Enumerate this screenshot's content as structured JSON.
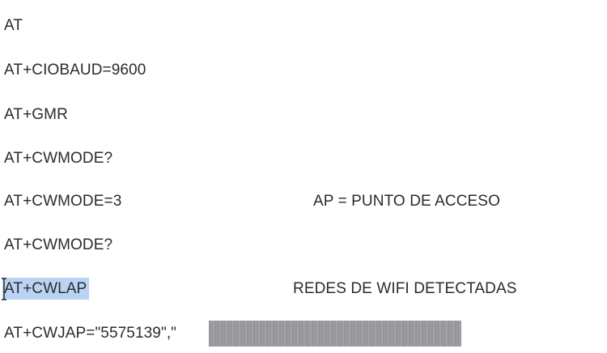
{
  "commands": {
    "at": "AT",
    "ciobaud": "AT+CIOBAUD=9600",
    "gmr": "AT+GMR",
    "cwmode_query_1": "AT+CWMODE?",
    "cwmode_set": "AT+CWMODE=3",
    "cwmode_query_2": "AT+CWMODE?",
    "cwlap": "AT+CWLAP",
    "cwjap_prefix": "AT+CWJAP=\"5575139\",\""
  },
  "notes": {
    "ap": "AP = PUNTO DE ACCESO",
    "wifi": "REDES DE WIFI DETECTADAS"
  },
  "colors": {
    "selection": "#b9d4f3",
    "text": "#2b2b2b"
  }
}
